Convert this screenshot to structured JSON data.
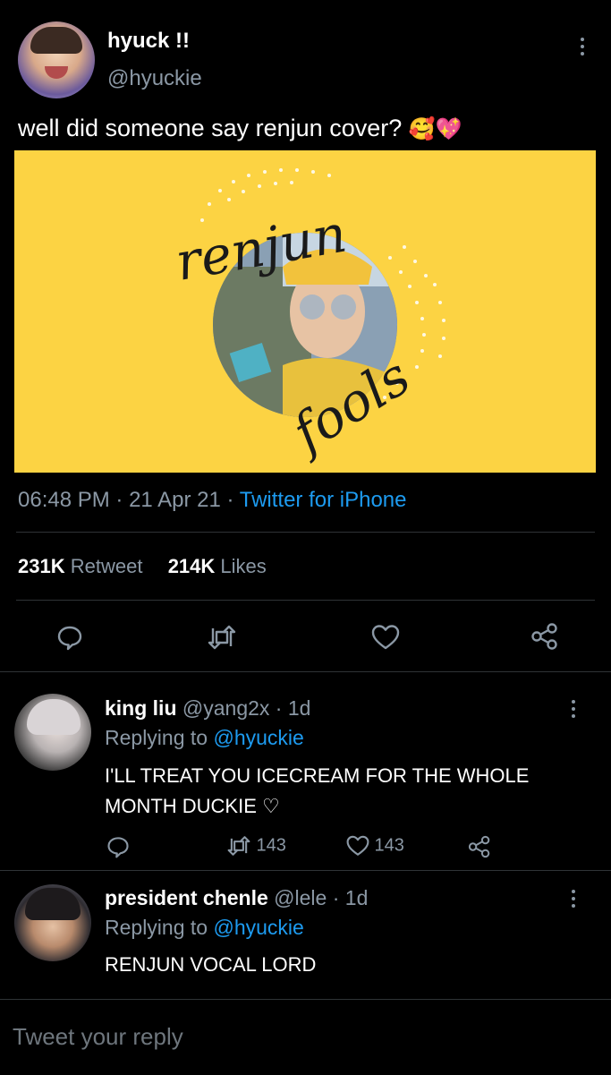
{
  "tweet": {
    "display_name": "hyuck !!",
    "handle": "@hyuckie",
    "text": "well did someone say renjun cover?",
    "emoji": "🥰💖",
    "media": {
      "script_top": "renjun",
      "script_bottom": "fools",
      "bg_color": "#fcd343"
    },
    "time": "06:48 PM",
    "date": "21 Apr 21",
    "source": "Twitter for iPhone",
    "retweets_count": "231K",
    "retweets_label": "Retweet",
    "likes_count": "214K",
    "likes_label": "Likes"
  },
  "actions": {
    "icons": [
      "reply-icon",
      "retweet-icon",
      "like-icon",
      "share-icon"
    ]
  },
  "replies": [
    {
      "name": "king liu",
      "handle": "@yang2x",
      "age": "1d",
      "replying_label": "Replying to",
      "replying_to": "@hyuckie",
      "text": "I'LL TREAT YOU ICECREAM FOR THE WHOLE MONTH DUCKIE ♡",
      "retweets": "143",
      "likes": "143"
    },
    {
      "name": "president chenle",
      "handle": "@lele",
      "age": "1d",
      "replying_label": "Replying to",
      "replying_to": "@hyuckie",
      "text": "RENJUN VOCAL LORD"
    }
  ],
  "composer": {
    "placeholder": "Tweet your reply"
  },
  "colors": {
    "accent": "#1d9bf0",
    "muted": "#8b98a5",
    "background": "#000000"
  }
}
